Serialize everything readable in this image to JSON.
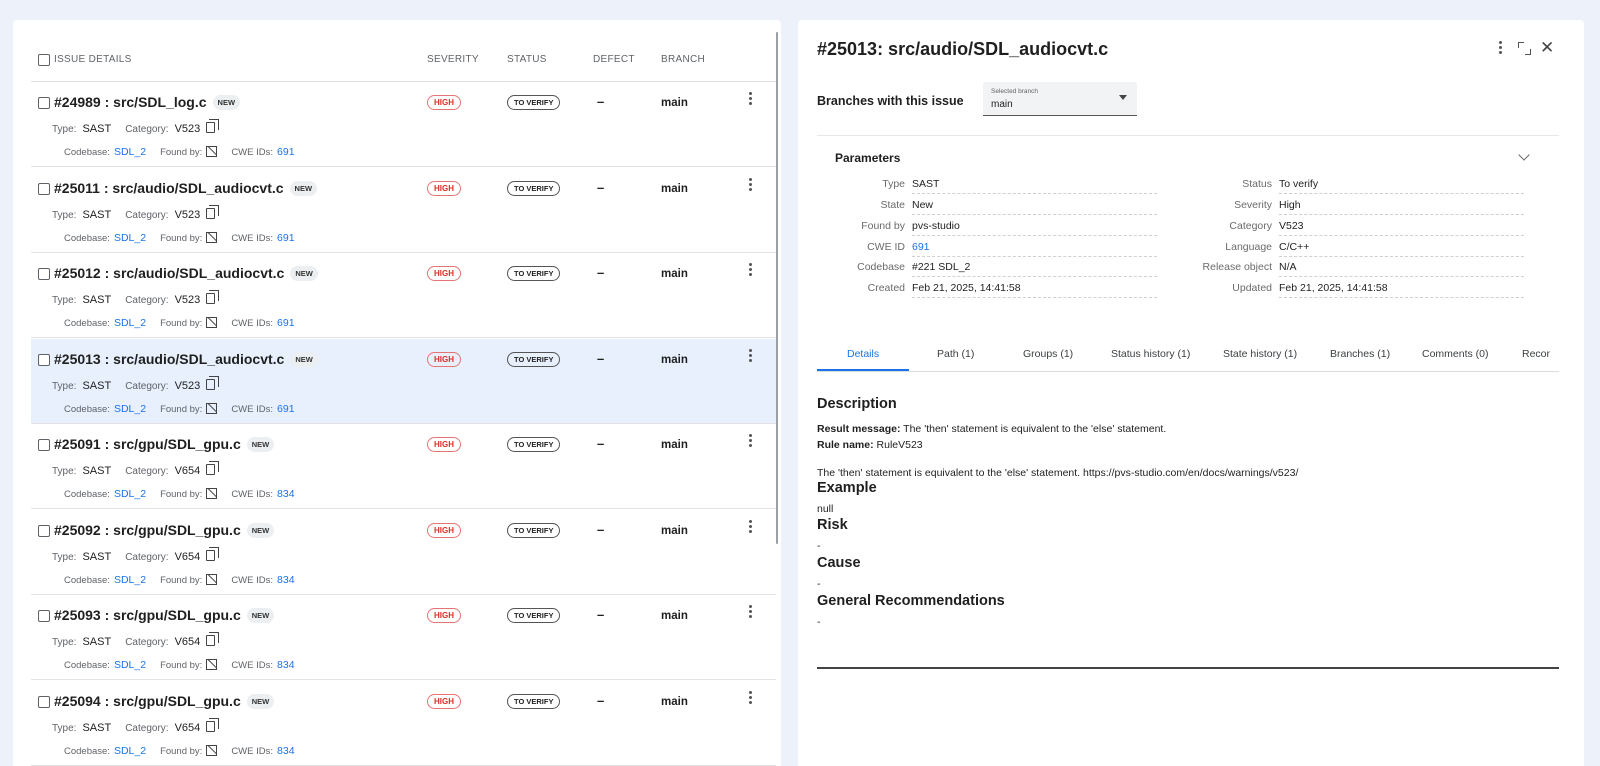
{
  "list": {
    "headers": {
      "details": "ISSUE DETAILS",
      "severity": "SEVERITY",
      "status": "STATUS",
      "defect": "DEFECT",
      "branch": "BRANCH"
    },
    "labels": {
      "type": "Type:",
      "category": "Category:",
      "codebase": "Codebase:",
      "found_by": "Found by:",
      "cwe_ids": "CWE IDs:",
      "new_badge": "NEW"
    },
    "rows": [
      {
        "title": "#24989 : src/SDL_log.c",
        "type": "SAST",
        "category": "V523",
        "codebase": "SDL_2",
        "cwe": "691",
        "severity": "HIGH",
        "status": "TO VERIFY",
        "defect": "–",
        "branch": "main",
        "selected": false
      },
      {
        "title": "#25011 : src/audio/SDL_audiocvt.c",
        "type": "SAST",
        "category": "V523",
        "codebase": "SDL_2",
        "cwe": "691",
        "severity": "HIGH",
        "status": "TO VERIFY",
        "defect": "–",
        "branch": "main",
        "selected": false
      },
      {
        "title": "#25012 : src/audio/SDL_audiocvt.c",
        "type": "SAST",
        "category": "V523",
        "codebase": "SDL_2",
        "cwe": "691",
        "severity": "HIGH",
        "status": "TO VERIFY",
        "defect": "–",
        "branch": "main",
        "selected": false
      },
      {
        "title": "#25013 : src/audio/SDL_audiocvt.c",
        "type": "SAST",
        "category": "V523",
        "codebase": "SDL_2",
        "cwe": "691",
        "severity": "HIGH",
        "status": "TO VERIFY",
        "defect": "–",
        "branch": "main",
        "selected": true
      },
      {
        "title": "#25091 : src/gpu/SDL_gpu.c",
        "type": "SAST",
        "category": "V654",
        "codebase": "SDL_2",
        "cwe": "834",
        "severity": "HIGH",
        "status": "TO VERIFY",
        "defect": "–",
        "branch": "main",
        "selected": false
      },
      {
        "title": "#25092 : src/gpu/SDL_gpu.c",
        "type": "SAST",
        "category": "V654",
        "codebase": "SDL_2",
        "cwe": "834",
        "severity": "HIGH",
        "status": "TO VERIFY",
        "defect": "–",
        "branch": "main",
        "selected": false
      },
      {
        "title": "#25093 : src/gpu/SDL_gpu.c",
        "type": "SAST",
        "category": "V654",
        "codebase": "SDL_2",
        "cwe": "834",
        "severity": "HIGH",
        "status": "TO VERIFY",
        "defect": "–",
        "branch": "main",
        "selected": false
      },
      {
        "title": "#25094 : src/gpu/SDL_gpu.c",
        "type": "SAST",
        "category": "V654",
        "codebase": "SDL_2",
        "cwe": "834",
        "severity": "HIGH",
        "status": "TO VERIFY",
        "defect": "–",
        "branch": "main",
        "selected": false
      }
    ]
  },
  "detail": {
    "title": "#25013: src/audio/SDL_audiocvt.c",
    "branches_label": "Branches with this issue",
    "branch_select": {
      "label": "Selected branch",
      "value": "main"
    },
    "parameters_title": "Parameters",
    "params_left": [
      {
        "k": "Type",
        "v": "SAST"
      },
      {
        "k": "State",
        "v": "New"
      },
      {
        "k": "Found by",
        "v": "pvs-studio"
      },
      {
        "k": "CWE ID",
        "v": "691"
      },
      {
        "k": "Codebase",
        "v": "#221 SDL_2"
      },
      {
        "k": "Created",
        "v": "Feb 21, 2025, 14:41:58"
      }
    ],
    "params_right": [
      {
        "k": "Status",
        "v": "To verify"
      },
      {
        "k": "Severity",
        "v": "High"
      },
      {
        "k": "Category",
        "v": "V523"
      },
      {
        "k": "Language",
        "v": "C/C++"
      },
      {
        "k": "Release object",
        "v": "N/A"
      },
      {
        "k": "Updated",
        "v": "Feb 21, 2025, 14:41:58"
      }
    ],
    "tabs": [
      "Details",
      "Path (1)",
      "Groups (1)",
      "Status history (1)",
      "State history (1)",
      "Branches (1)",
      "Comments (0)",
      "Recor"
    ],
    "content": {
      "description_heading": "Description",
      "result_label": "Result message:",
      "result_text": " The 'then' statement is equivalent to the 'else' statement.",
      "rule_label": "Rule name:",
      "rule_text": " RuleV523",
      "body_text": "The 'then' statement is equivalent to the 'else' statement. https://pvs-studio.com/en/docs/warnings/v523/",
      "example_heading": "Example",
      "example_text": "null",
      "risk_heading": "Risk",
      "risk_text": "-",
      "cause_heading": "Cause",
      "cause_text": "-",
      "recommend_heading": "General Recommendations",
      "recommend_text": "-"
    }
  }
}
